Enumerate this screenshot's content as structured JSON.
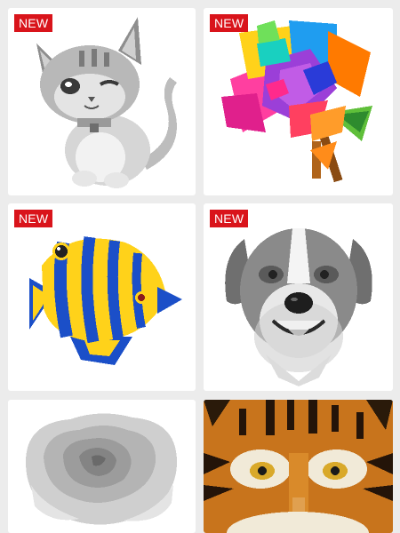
{
  "gallery": {
    "badge_text": "NEW",
    "items": [
      {
        "subject": "kitten",
        "is_new": true,
        "palette": "grayscale"
      },
      {
        "subject": "rainbow-rose",
        "is_new": true,
        "palette": "colored"
      },
      {
        "subject": "tropical-fish",
        "is_new": true,
        "palette": "colored"
      },
      {
        "subject": "dog",
        "is_new": true,
        "palette": "grayscale"
      },
      {
        "subject": "rose",
        "is_new": false,
        "palette": "grayscale"
      },
      {
        "subject": "tiger",
        "is_new": false,
        "palette": "colored"
      }
    ]
  },
  "colors": {
    "background": "#ececec",
    "card": "#ffffff",
    "badge": "#d9141b",
    "badge_text": "#ffffff"
  }
}
